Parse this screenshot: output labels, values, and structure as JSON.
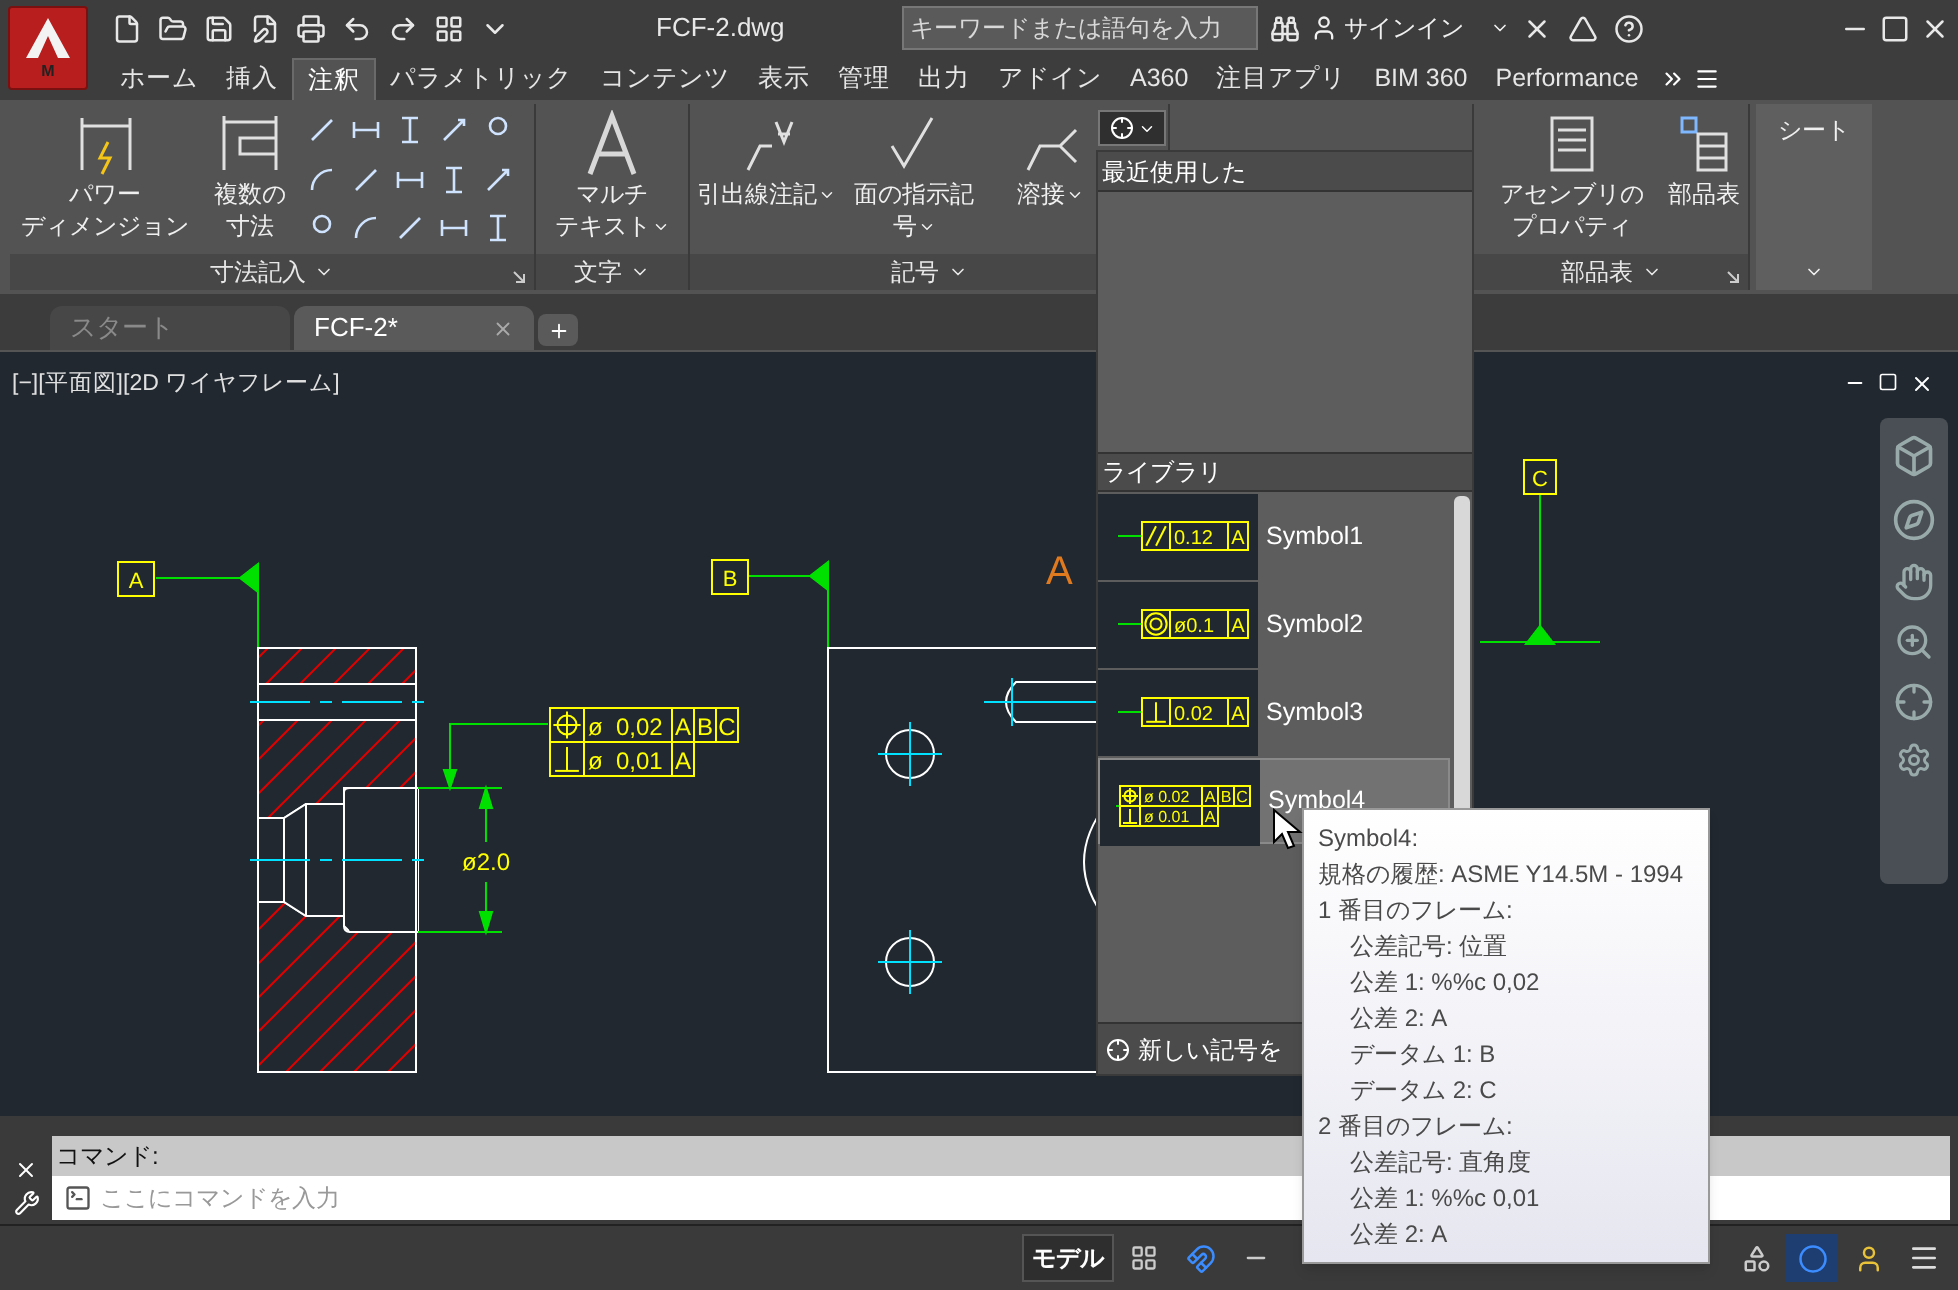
{
  "app_button": {
    "badge": "M"
  },
  "title_bar": {
    "title": "FCF-2.dwg",
    "search": {
      "placeholder": "キーワードまたは語句を入力"
    },
    "sign_in": "サインイン"
  },
  "ribbon_tabs": [
    {
      "label": "ホーム",
      "selected": false
    },
    {
      "label": "挿入",
      "selected": false
    },
    {
      "label": "注釈",
      "selected": true
    },
    {
      "label": "パラメトリック",
      "selected": false
    },
    {
      "label": "コンテンツ",
      "selected": false
    },
    {
      "label": "表示",
      "selected": false
    },
    {
      "label": "管理",
      "selected": false
    },
    {
      "label": "出力",
      "selected": false
    },
    {
      "label": "アドイン",
      "selected": false
    },
    {
      "label": "A360",
      "selected": false
    },
    {
      "label": "注目アプリ",
      "selected": false
    },
    {
      "label": "BIM 360",
      "selected": false
    },
    {
      "label": "Performance",
      "selected": false
    }
  ],
  "ribbon_panels": [
    {
      "kind": "dimension",
      "title": "寸法記入",
      "buttons": [
        {
          "lines": [
            "パワー",
            "ディメンジョン"
          ]
        },
        {
          "lines": [
            "複数の",
            "寸法"
          ]
        }
      ]
    },
    {
      "kind": "text",
      "title": "文字",
      "buttons": [
        {
          "lines": [
            "マルチ",
            "テキスト"
          ]
        }
      ]
    },
    {
      "kind": "symbol",
      "title": "記号",
      "buttons": [
        {
          "lines": [
            "引出線注記"
          ]
        },
        {
          "lines": [
            "面の指示記",
            "号"
          ]
        },
        {
          "lines": [
            "溶接"
          ]
        }
      ]
    },
    {
      "kind": "parts",
      "title": "部品表",
      "buttons": [
        {
          "lines": [
            "アセンブリの",
            "プロパティ"
          ]
        },
        {
          "lines": [
            "部品表"
          ]
        }
      ]
    },
    {
      "kind": "sheet",
      "title": "シート"
    }
  ],
  "doc_tabs": [
    {
      "label": "スタート",
      "selected": false
    },
    {
      "label": "FCF-2*",
      "selected": true
    }
  ],
  "viewport": {
    "label": "[−][平面図][2D ワイヤフレーム]",
    "datums": [
      "A",
      "B",
      "C"
    ],
    "section_label": "A",
    "dimension": "ø2.0",
    "frame": [
      {
        "kind": "position",
        "tolerance": "ø  0,02",
        "datums": [
          "A",
          "B",
          "C"
        ]
      },
      {
        "kind": "perpendicularity",
        "tolerance": "ø  0,01",
        "datums": [
          "A"
        ]
      }
    ]
  },
  "symbol_panel": {
    "recent_header": "最近使用した",
    "library_header": "ライブラリ",
    "items": [
      {
        "name": "Symbol1",
        "selected": false,
        "preview": [
          {
            "kind": "parallelism",
            "tolerance": "0.12",
            "datums": [
              "A"
            ]
          }
        ]
      },
      {
        "name": "Symbol2",
        "selected": false,
        "preview": [
          {
            "kind": "concentricity",
            "tolerance": "ø0.1",
            "datums": [
              "A"
            ]
          }
        ]
      },
      {
        "name": "Symbol3",
        "selected": false,
        "preview": [
          {
            "kind": "perpendicularity",
            "tolerance": "0.02",
            "datums": [
              "A"
            ]
          }
        ]
      },
      {
        "name": "Symbol4",
        "selected": true,
        "preview": [
          {
            "kind": "position",
            "tolerance": "ø 0.02",
            "datums": [
              "A",
              "B",
              "C"
            ]
          },
          {
            "kind": "perpendicularity",
            "tolerance": "ø 0.01",
            "datums": [
              "A"
            ]
          }
        ]
      }
    ],
    "new_button": "新しい記号を"
  },
  "tooltip": {
    "title": "Symbol4:",
    "standard": "規格の履歴: ASME Y14.5M - 1994",
    "frames": [
      {
        "heading": "1 番目のフレーム:",
        "children": [
          "公差記号: 位置",
          "公差 1: %%c 0,02",
          "公差 2: A",
          "データム 1: B",
          "データム 2: C"
        ]
      },
      {
        "heading": "2 番目のフレーム:",
        "children": [
          "公差記号: 直角度",
          "公差 1: %%c 0,01",
          "公差 2: A"
        ]
      }
    ]
  },
  "command_line": {
    "prompt": "コマンド:",
    "input": {
      "placeholder": "ここにコマンドを入力"
    }
  },
  "status_bar": {
    "model": "モデル"
  }
}
